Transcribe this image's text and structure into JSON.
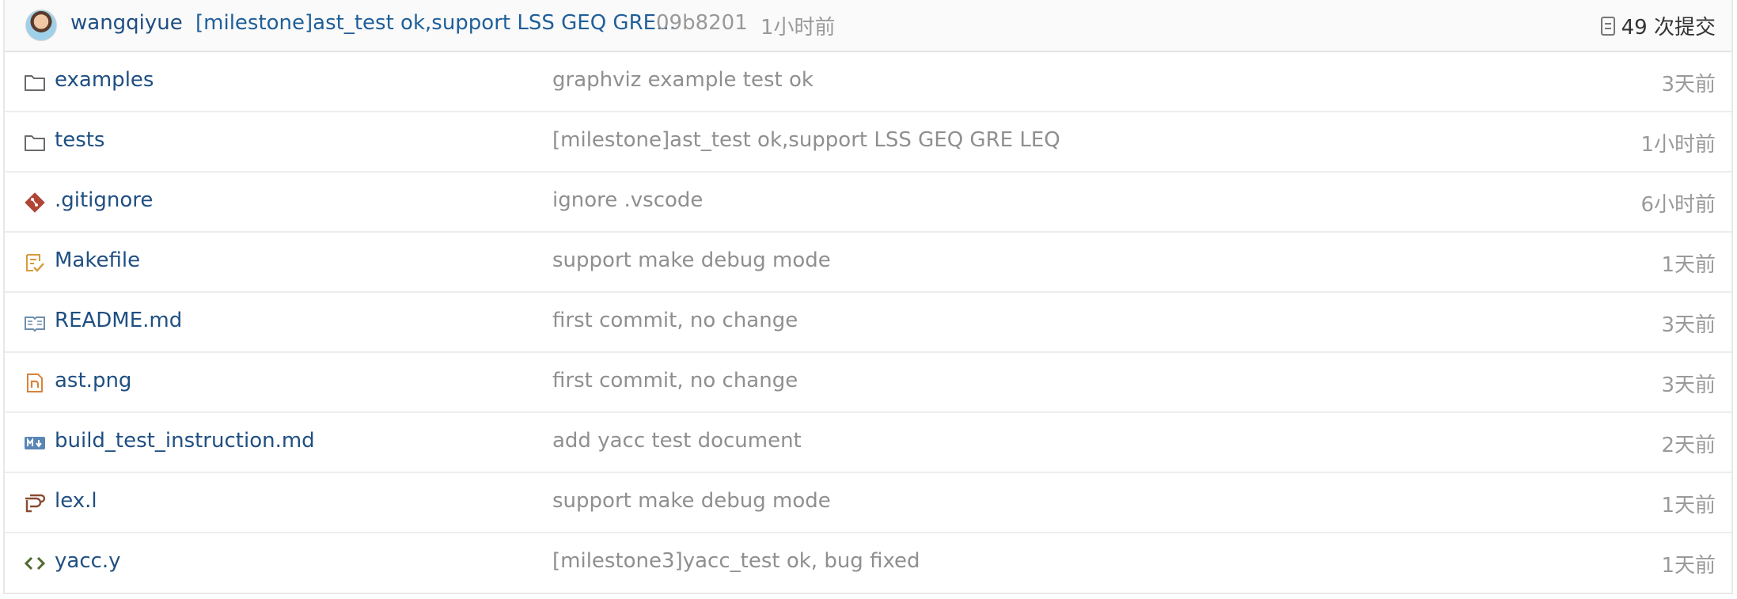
{
  "latest_commit": {
    "author": "wangqiyue",
    "message": "[milestone]ast_test ok,support LSS GEQ GRE...",
    "sha": "09b8201",
    "time": "1小时前",
    "commit_count": "49 次提交"
  },
  "files": [
    {
      "name": "examples",
      "message": "graphviz example test ok",
      "time": "3天前",
      "icon": "folder-icon"
    },
    {
      "name": "tests",
      "message": "[milestone]ast_test ok,support LSS GEQ GRE LEQ",
      "time": "1小时前",
      "icon": "folder-icon"
    },
    {
      "name": ".gitignore",
      "message": "ignore .vscode",
      "time": "6小时前",
      "icon": "git-icon"
    },
    {
      "name": "Makefile",
      "message": "support make debug mode",
      "time": "1天前",
      "icon": "makefile-icon"
    },
    {
      "name": "README.md",
      "message": "first commit, no change",
      "time": "3天前",
      "icon": "readme-icon"
    },
    {
      "name": "ast.png",
      "message": "first commit, no change",
      "time": "3天前",
      "icon": "image-icon"
    },
    {
      "name": "build_test_instruction.md",
      "message": "add yacc test document",
      "time": "2天前",
      "icon": "markdown-icon"
    },
    {
      "name": "lex.l",
      "message": "support make debug mode",
      "time": "1天前",
      "icon": "lex-icon"
    },
    {
      "name": "yacc.y",
      "message": "[milestone3]yacc_test ok, bug fixed",
      "time": "1天前",
      "icon": "code-icon"
    }
  ],
  "colors": {
    "link": "#1f4f82",
    "muted": "#8f8f8f",
    "header_bg": "#fafafa"
  }
}
